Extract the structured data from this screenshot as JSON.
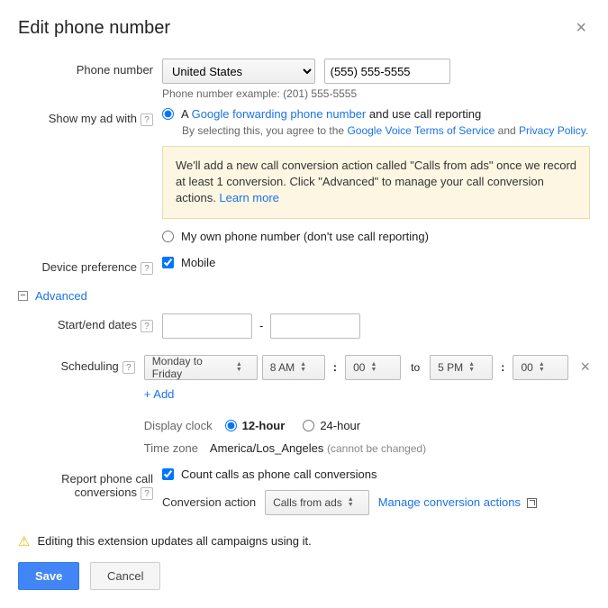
{
  "header": {
    "title": "Edit phone number"
  },
  "phone": {
    "label": "Phone number",
    "country": "United States",
    "value": "(555) 555-5555",
    "example": "Phone number example: (201) 555-5555"
  },
  "showAd": {
    "label": "Show my ad with",
    "opt1_prefix": "A ",
    "opt1_link": "Google forwarding phone number",
    "opt1_suffix": " and use call reporting",
    "agree_prefix": "By selecting this, you agree to the ",
    "tos": "Google Voice Terms of Service",
    "and": " and ",
    "privacy": "Privacy Policy",
    "dot": ".",
    "info_text": "We'll add a new call conversion action called \"Calls from ads\" once we record at least 1 conversion. Click \"Advanced\" to manage your call conversion actions. ",
    "learn_more": "Learn more",
    "opt2": "My own phone number (don't use call reporting)"
  },
  "device": {
    "label": "Device preference",
    "mobile": "Mobile"
  },
  "advanced": {
    "title": "Advanced",
    "dates_label": "Start/end dates",
    "sched_label": "Scheduling",
    "days": "Monday to Friday",
    "start_hour": "8 AM",
    "start_min": "00",
    "to": "to",
    "end_hour": "5 PM",
    "end_min": "00",
    "add": "+ Add",
    "clock_label": "Display clock",
    "h12": "12-hour",
    "h24": "24-hour",
    "tz_label": "Time zone",
    "tz_value": "America/Los_Angeles",
    "tz_note": "(cannot be changed)"
  },
  "report": {
    "label": "Report phone call conversions",
    "count": "Count calls as phone call conversions",
    "action_label": "Conversion action",
    "action_value": "Calls from ads",
    "manage": "Manage conversion actions"
  },
  "warning": "Editing this extension updates all campaigns using it.",
  "buttons": {
    "save": "Save",
    "cancel": "Cancel"
  }
}
